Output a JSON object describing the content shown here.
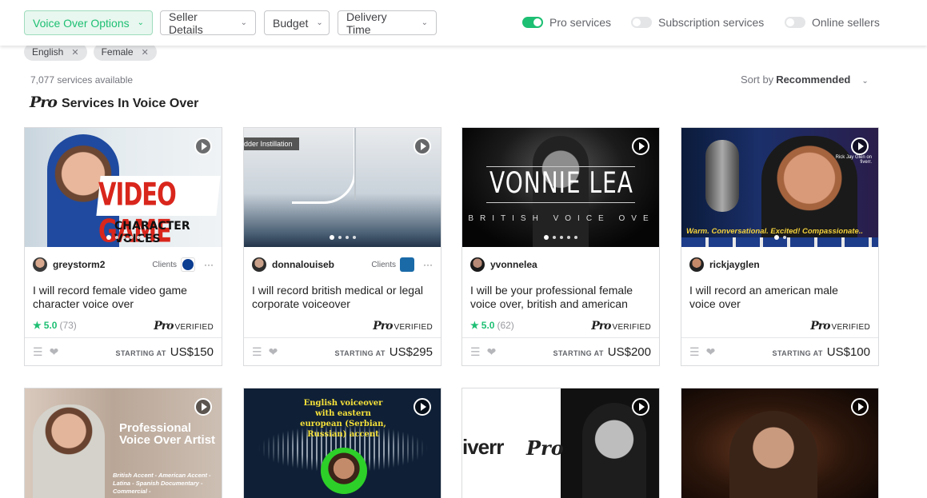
{
  "filters": {
    "voice_over_options": "Voice Over Options",
    "seller_details": "Seller Details",
    "budget": "Budget",
    "delivery_time": "Delivery Time"
  },
  "toggles": {
    "pro_services": "Pro services",
    "subscription_services": "Subscription services",
    "online_sellers": "Online sellers"
  },
  "chips": [
    "English",
    "Female"
  ],
  "results": {
    "count": "7,077 services available",
    "sort_label": "Sort by",
    "sort_value": "Recommended",
    "heading_logo": "Pro",
    "heading": "Services In Voice Over"
  },
  "labels": {
    "clients": "Clients",
    "starting_at": "STARTING AT",
    "verified": "VERIFIED",
    "pro": "Pro"
  },
  "cards": [
    {
      "seller": "greystorm2",
      "title": "I will record female video game character voice over",
      "rating": "5.0",
      "reviews": "(73)",
      "price": "US$150",
      "thumb_text_1": "VIDEO GAME",
      "thumb_text_2": "CHARACTER VOICES"
    },
    {
      "seller": "donnalouiseb",
      "title": "I will record british medical or legal corporate voiceover",
      "price": "US$295",
      "thumb_text_1": "dder Instillation"
    },
    {
      "seller": "yvonnelea",
      "title": "I will be your professional female voice over, british and american",
      "rating": "5.0",
      "reviews": "(62)",
      "price": "US$200",
      "thumb_text_1": "VONNIE LEA",
      "thumb_text_2": "BRITISH VOICE OVE"
    },
    {
      "seller": "rickjayglen",
      "title": "I will record an american male voice over",
      "price": "US$100",
      "thumb_text_1": "Warm. Conversational. Excited! Compassionate..",
      "thumb_text_2": "Rick Jay Glen on fiverr."
    },
    {
      "thumb_text_1": "Professional Voice Over Artist",
      "thumb_text_2": "British Accent - American Accent - Latina - Spanish Documentary - Commercial -"
    },
    {
      "thumb_text_1": "English voiceover with eastern european (Serbian, Russian) accent"
    },
    {
      "thumb_text_1": "iverr",
      "thumb_text_2": "Pro"
    },
    {}
  ],
  "colors": {
    "accent": "#1dbf73",
    "star": "#1dbf73"
  }
}
